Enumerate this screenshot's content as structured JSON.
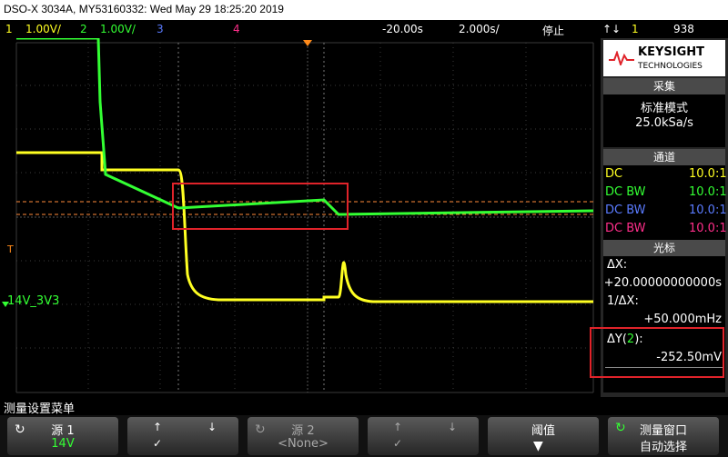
{
  "titlebar": {
    "text": "DSO-X 3034A, MY53160332: Wed May 29 18:25:20 2019"
  },
  "status": {
    "ch1_num": "1",
    "ch1_scale": "1.00V/",
    "ch2_num": "2",
    "ch2_scale": "1.00V/",
    "ch3_num": "3",
    "ch4_num": "4",
    "delay": "-20.00s",
    "timebase": "2.000s/",
    "run_state": "停止",
    "trig_icon": "↑↓",
    "trig_ch": "1",
    "trig_level": "938"
  },
  "colors": {
    "ch1": "#ffff22",
    "ch2": "#33ff33",
    "ch3": "#5a7bff",
    "ch4": "#ff2e8a",
    "accent": "#e0232a"
  },
  "screen": {
    "ch2_label": "14V_3V3",
    "trig_marker": "T"
  },
  "brand": {
    "name": "KEYSIGHT",
    "sub": "TECHNOLOGIES"
  },
  "acquire": {
    "header": "采集",
    "mode": "标准模式",
    "rate": "25.0kSa/s"
  },
  "channels": {
    "header": "通道",
    "rows": [
      {
        "coupling": "DC",
        "probe": "10.0:1"
      },
      {
        "coupling": "DC BW",
        "probe": "10.0:1"
      },
      {
        "coupling": "DC BW",
        "probe": "10.0:1"
      },
      {
        "coupling": "DC BW",
        "probe": "10.0:1"
      }
    ]
  },
  "cursors": {
    "header": "光标",
    "dx_label": "ΔX:",
    "dx_value": "+20.00000000000s",
    "inv_label": "1/ΔX:",
    "inv_value": "+50.000mHz",
    "dy_label": "ΔY(",
    "dy_ch": "2",
    "dy_tail": "):",
    "dy_value": "-252.50mV"
  },
  "menu": {
    "title": "测量设置菜单"
  },
  "softkeys": {
    "source1_label": "源 1",
    "source1_value": "14V",
    "source2_label": "源 2",
    "source2_value": "<None>",
    "threshold_label": "阈值",
    "window_label": "测量窗口",
    "window_value": "自动选择"
  }
}
